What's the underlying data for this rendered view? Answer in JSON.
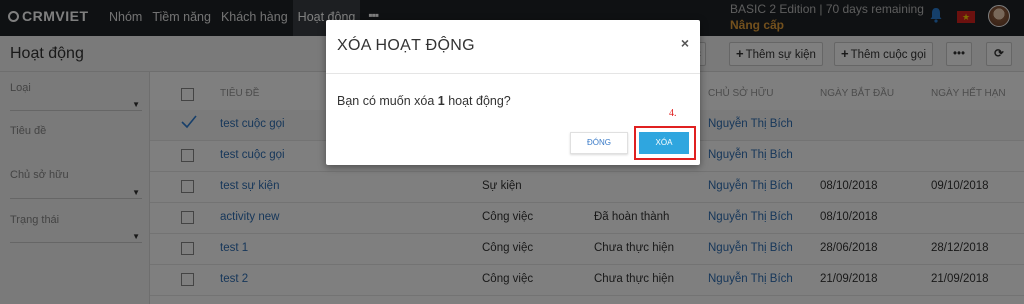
{
  "app": {
    "logo": "CRMVIET"
  },
  "nav": {
    "items": [
      "Nhóm",
      "Tiềm năng",
      "Khách hàng",
      "Hoạt động"
    ],
    "more": "▪▪▪"
  },
  "header_right": {
    "edition": "BASIC 2 Edition | 70 days remaining",
    "upgrade": "Nâng cấp"
  },
  "page": {
    "title": "Hoạt động",
    "buttons": {
      "partial": "c",
      "add_event": "Thêm sự kiện",
      "add_call": "Thêm cuộc gọi",
      "more": "•••",
      "refresh": "⟳"
    }
  },
  "filters": {
    "type_label": "Loại",
    "title_label": "Tiêu đề",
    "owner_label": "Chủ sở hữu",
    "status_label": "Trạng thái"
  },
  "table": {
    "headers": {
      "title": "TIÊU ĐỀ",
      "owner": "CHỦ SỞ HỮU",
      "start": "NGÀY BẮT ĐẦU",
      "end": "NGÀY HẾT HẠN"
    },
    "rows": [
      {
        "title": "test cuộc gọi",
        "type": "",
        "status": "",
        "owner": "Nguyễn Thị Bích",
        "start": "",
        "end": "",
        "selected": true
      },
      {
        "title": "test cuộc gọi",
        "type": "",
        "status": "",
        "owner": "Nguyễn Thị Bích",
        "start": "",
        "end": "",
        "selected": false
      },
      {
        "title": "test sự kiện",
        "type": "Sự kiện",
        "status": "",
        "owner": "Nguyễn Thị Bích",
        "start": "08/10/2018",
        "end": "09/10/2018",
        "selected": false
      },
      {
        "title": "activity new",
        "type": "Công việc",
        "status": "Đã hoàn thành",
        "owner": "Nguyễn Thị Bích",
        "start": "08/10/2018",
        "end": "",
        "selected": false
      },
      {
        "title": "test 1",
        "type": "Công việc",
        "status": "Chưa thực hiện",
        "owner": "Nguyễn Thị Bích",
        "start": "28/06/2018",
        "end": "28/12/2018",
        "selected": false
      },
      {
        "title": "test 2",
        "type": "Công việc",
        "status": "Chưa thực hiện",
        "owner": "Nguyễn Thị Bích",
        "start": "21/09/2018",
        "end": "21/09/2018",
        "selected": false
      }
    ]
  },
  "modal": {
    "title": "XÓA HOẠT ĐỘNG",
    "close": "×",
    "body_prefix": "Bạn có muốn xóa ",
    "body_count": "1",
    "body_suffix": " hoạt động?",
    "btn_close": "ĐÓNG",
    "btn_delete": "XÓA",
    "step_label": "4."
  },
  "colors": {
    "accent": "#2fa6df",
    "link": "#2f6fb5",
    "highlight": "#e02020",
    "topbar": "#1f2327"
  },
  "icons": [
    "bell-icon",
    "vietnam-flag-icon",
    "user-avatar",
    "checkmark-icon",
    "close-icon",
    "refresh-icon",
    "plus-icon",
    "caret-down-icon"
  ]
}
